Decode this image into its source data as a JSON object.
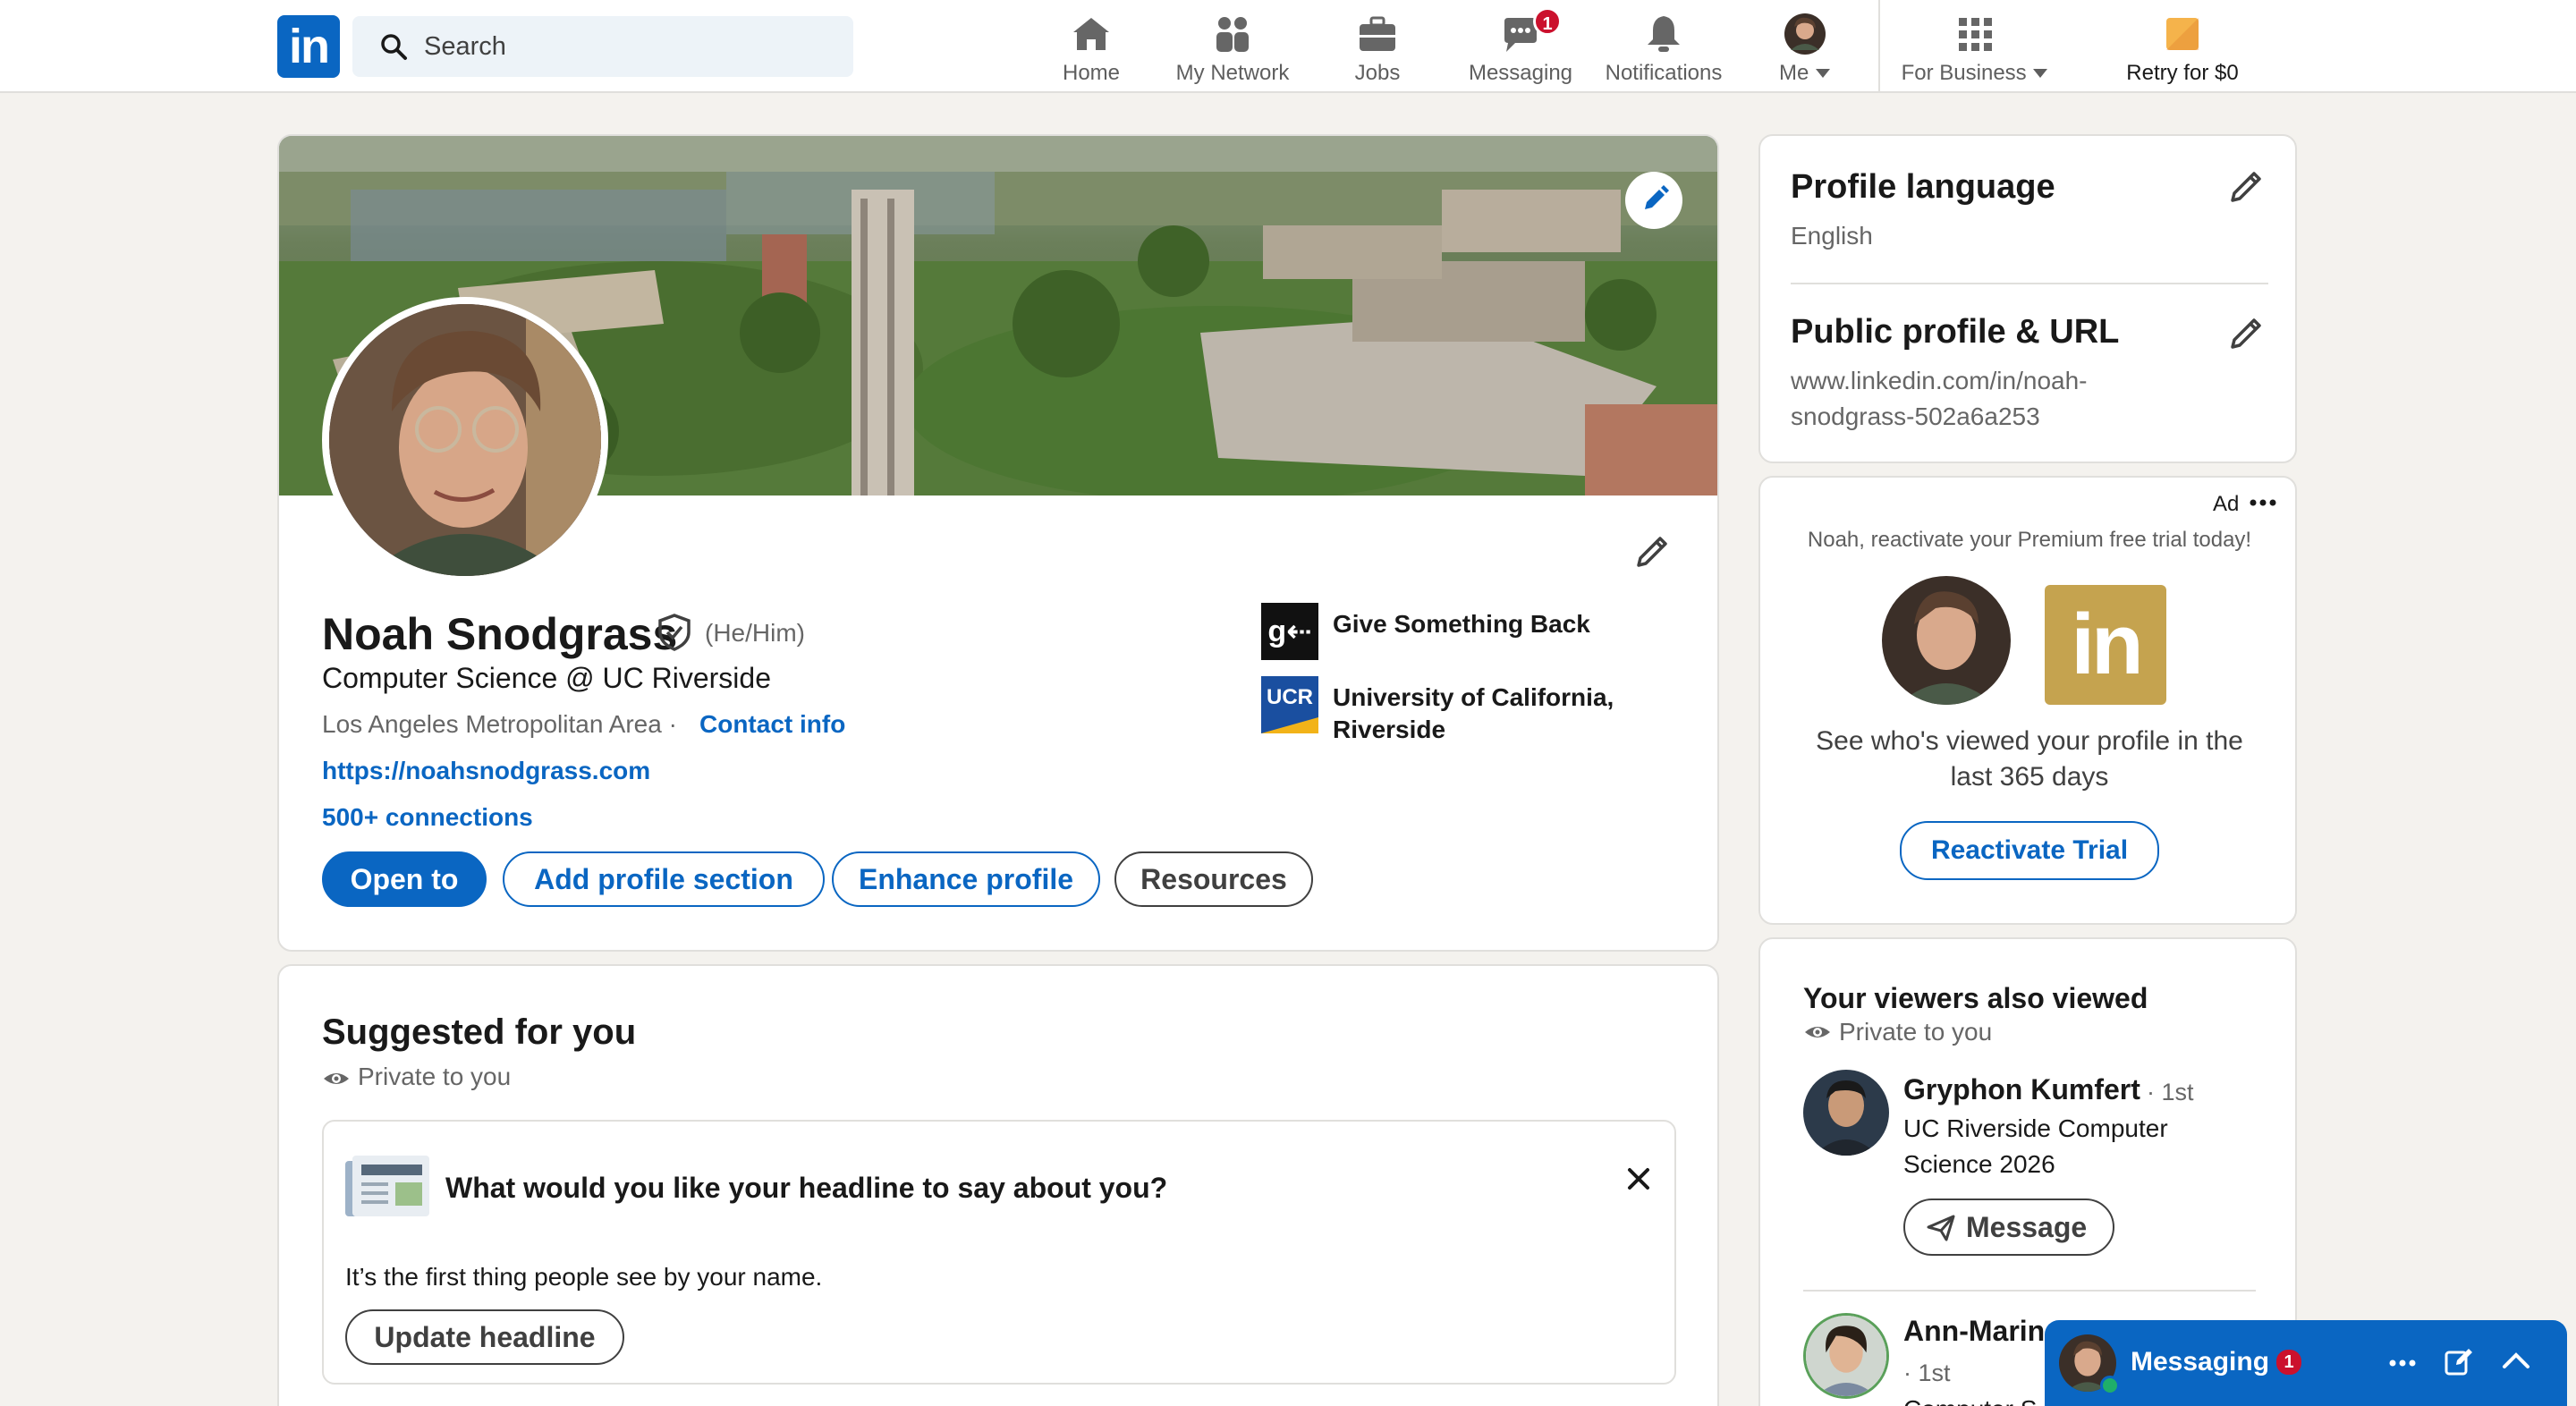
{
  "nav": {
    "search_placeholder": "Search",
    "items": [
      {
        "label": "Home",
        "icon": "home-icon"
      },
      {
        "label": "My Network",
        "icon": "network-icon"
      },
      {
        "label": "Jobs",
        "icon": "briefcase-icon"
      },
      {
        "label": "Messaging",
        "icon": "messaging-icon",
        "badge": "1"
      },
      {
        "label": "Notifications",
        "icon": "bell-icon"
      },
      {
        "label": "Me",
        "icon": "avatar"
      },
      {
        "label": "For Business",
        "icon": "grid-icon"
      },
      {
        "label": "Retry for $0",
        "icon": "premium-icon"
      }
    ]
  },
  "profile": {
    "name": "Noah Snodgrass",
    "pronouns": "(He/Him)",
    "headline": "Computer Science @ UC Riverside",
    "location": "Los Angeles Metropolitan Area ·",
    "contact_info": "Contact info",
    "website": "https://noahsnodgrass.com",
    "connections": "500+ connections",
    "buttons": {
      "open_to": "Open to",
      "add_section": "Add profile section",
      "enhance": "Enhance profile",
      "resources": "Resources"
    },
    "orgs": [
      {
        "name": "Give Something Back",
        "logo_text": "g⇠"
      },
      {
        "name": "University of California, Riverside",
        "logo_text": "UCR"
      }
    ]
  },
  "suggested": {
    "title": "Suggested for you",
    "private": "Private to you",
    "question": "What would you like your headline to say about you?",
    "text": "It’s the first thing people see by your name.",
    "button": "Update headline"
  },
  "language_card": {
    "lang_title": "Profile language",
    "lang_value": "English",
    "url_title": "Public profile & URL",
    "url_line1": "www.linkedin.com/in/noah-",
    "url_line2": "snodgrass-502a6a253"
  },
  "ad_card": {
    "ad_label": "Ad",
    "promo": "Noah, reactivate your Premium free trial today!",
    "logo_text": "in",
    "line1": "See who's viewed your profile in the",
    "line2": "last 365 days",
    "button": "Reactivate Trial"
  },
  "viewers": {
    "title": "Your viewers also viewed",
    "private": "Private to you",
    "people": [
      {
        "name": "Gryphon Kumfert",
        "degree": "· 1st",
        "line1": "UC Riverside Computer",
        "line2": "Science 2026",
        "button": "Message"
      },
      {
        "name": "Ann-Marin",
        "degree": "· 1st",
        "line1": "Computer S"
      }
    ]
  },
  "messaging": {
    "label": "Messaging",
    "badge": "1"
  },
  "colors": {
    "brand": "#0a66c2",
    "badge": "#cb112d",
    "background": "#f4f2ee"
  }
}
